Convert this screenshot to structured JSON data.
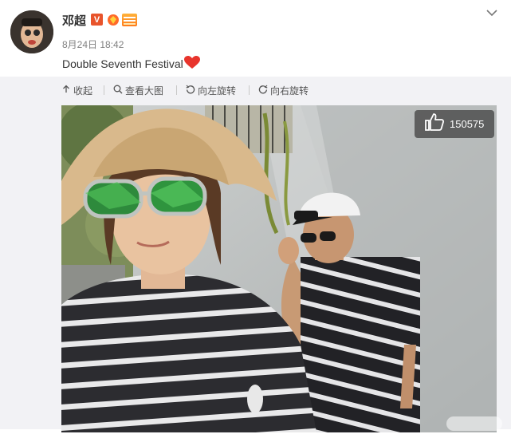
{
  "post": {
    "username": "邓超",
    "timestamp": "8月24日 18:42",
    "text": "Double Seventh Festival",
    "heart_icon": "red-heart-emoji",
    "verified_badge": "V"
  },
  "toolbar": {
    "collapse_label": "收起",
    "view_large_label": "查看大图",
    "rotate_left_label": "向左旋转",
    "rotate_right_label": "向右旋转"
  },
  "image": {
    "like_count": "150575"
  },
  "colors": {
    "verified": "#e8542c",
    "heart": "#e8342c",
    "toolbar_bg": "#f2f2f5"
  }
}
